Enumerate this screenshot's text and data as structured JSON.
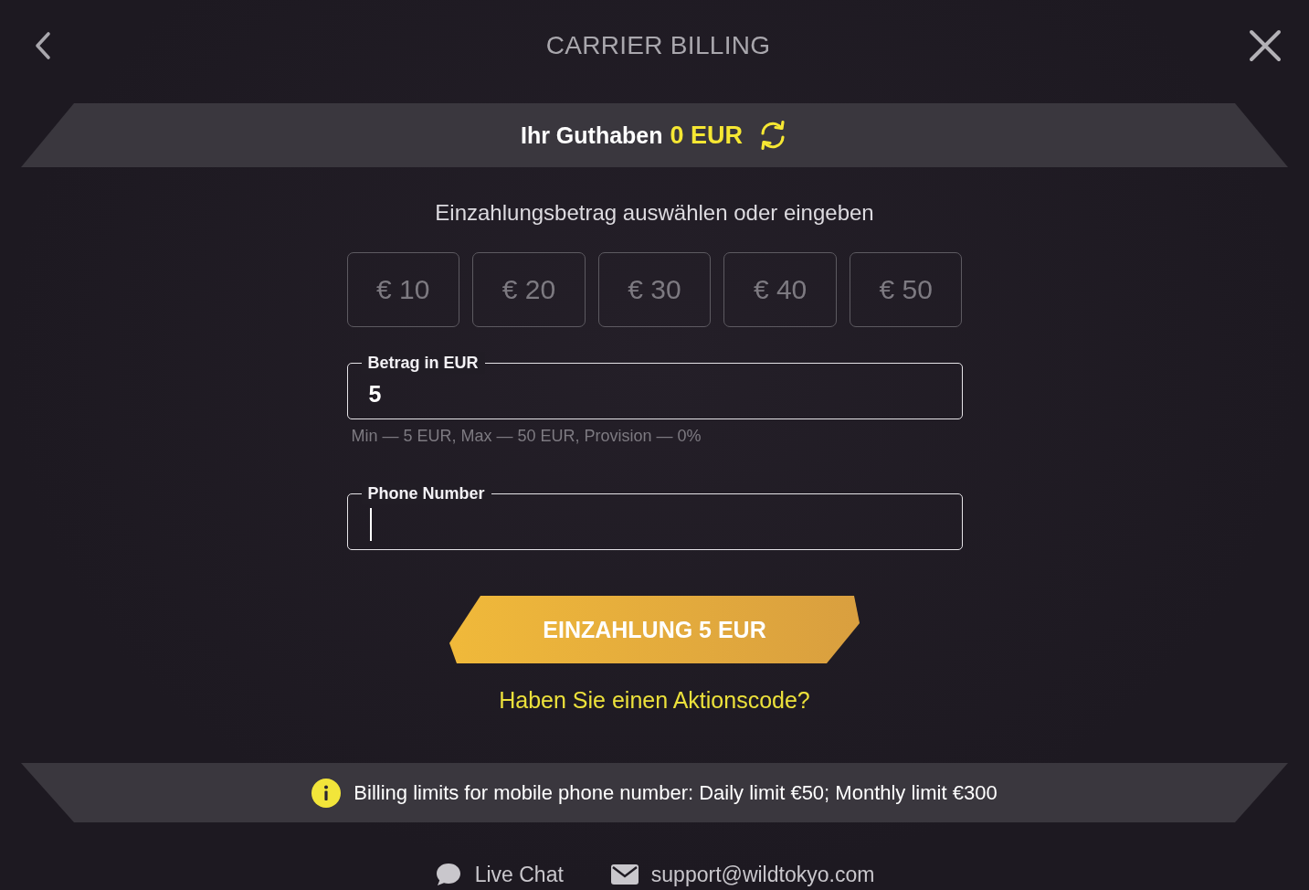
{
  "header": {
    "title": "CARRIER BILLING"
  },
  "balance": {
    "label": "Ihr Guthaben",
    "amount": "0 EUR"
  },
  "deposit": {
    "heading": "Einzahlungsbetrag auswählen oder eingeben",
    "presets": [
      {
        "label": "€ 10",
        "selected": false
      },
      {
        "label": "€ 20",
        "selected": false
      },
      {
        "label": "€ 30",
        "selected": false
      },
      {
        "label": "€ 40",
        "selected": false
      },
      {
        "label": "€ 50",
        "selected": false
      }
    ],
    "amount_field": {
      "label": "Betrag in EUR",
      "value": "5"
    },
    "hint": "Min — 5 EUR, Max — 50 EUR, Provision — 0%",
    "phone_field": {
      "label": "Phone Number",
      "focused": true
    },
    "submit": "EINZAHLUNG 5 EUR",
    "promo_link": "Haben Sie einen Aktionscode?"
  },
  "notice": {
    "text": "Billing limits for mobile phone number: Daily limit €50; Monthly limit €300"
  },
  "footer": {
    "links": [
      {
        "kind": "chat",
        "label": "Live Chat"
      },
      {
        "kind": "email",
        "label": "support@wildtokyo.com"
      }
    ]
  }
}
